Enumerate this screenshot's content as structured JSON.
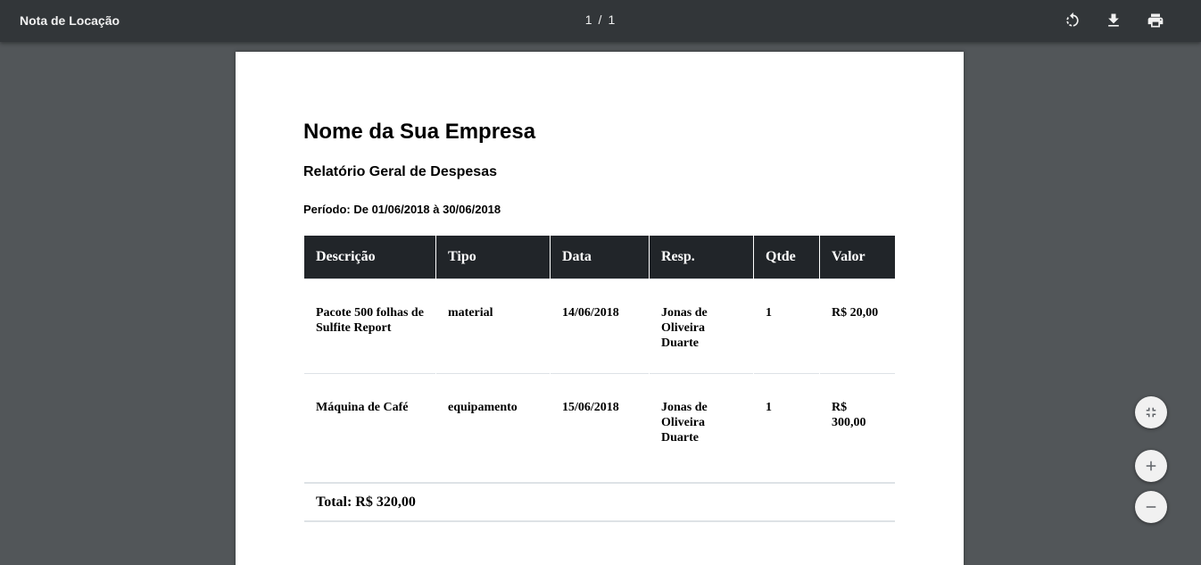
{
  "toolbar": {
    "title": "Nota de Locação",
    "current_page": "1",
    "separator": "/",
    "total_pages": "1",
    "icons": [
      "rotate-icon",
      "download-icon",
      "print-icon"
    ]
  },
  "document": {
    "company": "Nome da Sua Empresa",
    "report_title": "Relatório Geral de Despesas",
    "period": "Período: De 01/06/2018 à 30/06/2018",
    "table": {
      "headers": [
        "Descrição",
        "Tipo",
        "Data",
        "Resp.",
        "Qtde",
        "Valor"
      ],
      "rows": [
        [
          "Pacote 500 folhas de Sulfite Report",
          "material",
          "14/06/2018",
          "Jonas de Oliveira Duarte",
          "1",
          "R$ 20,00"
        ],
        [
          "Máquina de Café",
          "equipamento",
          "15/06/2018",
          "Jonas de Oliveira Duarte",
          "1",
          "R$ 300,00"
        ]
      ],
      "total": "Total: R$ 320,00"
    }
  },
  "zoom_controls": {
    "icons": [
      "fit-to-page-icon",
      "zoom-in-icon",
      "zoom-out-icon"
    ]
  },
  "colors": {
    "toolbar_bg": "#323639",
    "viewer_bg": "#525659",
    "table_header_bg": "#212529"
  }
}
